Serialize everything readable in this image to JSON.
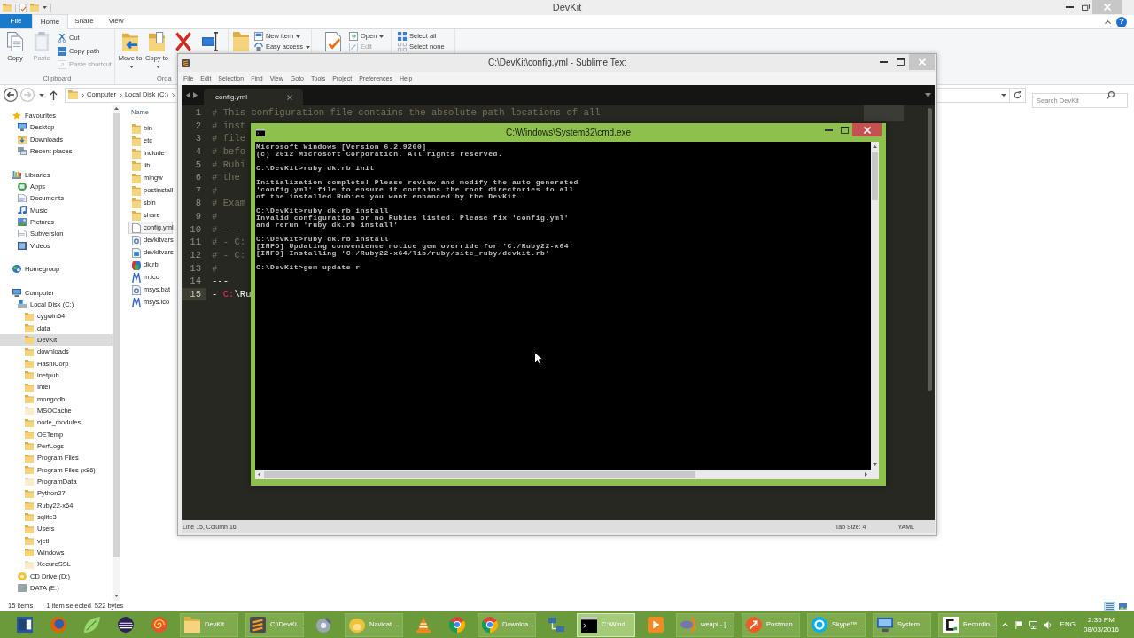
{
  "explorer": {
    "title": "DevKit",
    "active": false,
    "ribbon": {
      "tabs": [
        {
          "label": "File",
          "kind": "file",
          "selected": false
        },
        {
          "label": "Home",
          "kind": "tab",
          "selected": true
        },
        {
          "label": "Share",
          "kind": "tab",
          "selected": false
        },
        {
          "label": "View",
          "kind": "tab",
          "selected": false
        }
      ],
      "help": "?",
      "groups": [
        {
          "label": "Clipboard",
          "large": [
            {
              "kind": "copy",
              "label": "Copy",
              "dropdown": false,
              "disabled": false
            },
            {
              "kind": "paste",
              "label": "Paste",
              "dropdown": false,
              "disabled": true
            }
          ],
          "small": [
            {
              "kind": "cut",
              "label": "Cut",
              "dropdown": false,
              "disabled": false
            },
            {
              "kind": "copy-path",
              "label": "Copy path",
              "dropdown": false,
              "disabled": false
            },
            {
              "kind": "paste-shortcut",
              "label": "Paste shortcut",
              "dropdown": false,
              "disabled": true
            }
          ]
        },
        {
          "label": "Orga",
          "large": [
            {
              "kind": "move",
              "label": "Move to",
              "dropdown": true,
              "disabled": false
            },
            {
              "kind": "copy-to",
              "label": "Copy to",
              "dropdown": true,
              "disabled": false
            },
            {
              "kind": "delete",
              "disabled": false
            },
            {
              "kind": "rename",
              "disabled": false
            }
          ]
        },
        {
          "large": [
            {
              "kind": "new-folder",
              "disabled": false
            }
          ],
          "small": [
            {
              "kind": "new-item",
              "label": "New item",
              "dropdown": true,
              "disabled": false
            },
            {
              "kind": "easy-access",
              "label": "Easy access",
              "dropdown": true,
              "disabled": false
            }
          ]
        },
        {
          "large": [
            {
              "kind": "properties",
              "disabled": false
            }
          ],
          "small": [
            {
              "kind": "open",
              "label": "Open",
              "dropdown": true,
              "disabled": false
            },
            {
              "kind": "edit",
              "label": "Edit",
              "dropdown": false,
              "disabled": true
            }
          ]
        },
        {
          "small": [
            {
              "kind": "select-all",
              "label": "Select all",
              "dropdown": false,
              "disabled": false
            },
            {
              "kind": "select-none",
              "label": "Select none",
              "dropdown": false,
              "disabled": false
            }
          ]
        }
      ]
    },
    "address": {
      "crumbs": [
        "Computer",
        "Local Disk (C:)"
      ]
    },
    "search": {
      "placeholder": "Search DevKit"
    },
    "navigation": [
      {
        "label": "Favourites",
        "kind": "star",
        "selected": false,
        "children": [
          {
            "label": "Desktop",
            "kind": "desktop",
            "selected": false
          },
          {
            "label": "Downloads",
            "kind": "downloads",
            "selected": false
          },
          {
            "label": "Recent places",
            "kind": "recent",
            "selected": false
          }
        ]
      },
      {
        "label": "Libraries",
        "kind": "library",
        "selected": false,
        "children": [
          {
            "label": "Apps",
            "kind": "apps",
            "selected": false
          },
          {
            "label": "Documents",
            "kind": "documents",
            "selected": false
          },
          {
            "label": "Music",
            "kind": "music",
            "selected": false
          },
          {
            "label": "Pictures",
            "kind": "pictures",
            "selected": false
          },
          {
            "label": "Subversion",
            "kind": "subversion",
            "selected": false
          },
          {
            "label": "Videos",
            "kind": "videos",
            "selected": false
          }
        ]
      },
      {
        "label": "Homegroup",
        "kind": "homegroup",
        "selected": false
      },
      {
        "label": "Computer",
        "kind": "computer",
        "selected": false,
        "children": [
          {
            "label": "Local Disk (C:)",
            "kind": "disk",
            "selected": false,
            "children": [
              {
                "label": "cygwin64",
                "kind": "folder",
                "selected": false,
                "hidden": false
              },
              {
                "label": "data",
                "kind": "folder",
                "selected": false,
                "hidden": false
              },
              {
                "label": "DevKit",
                "kind": "folder",
                "selected": true,
                "hidden": false
              },
              {
                "label": "downloads",
                "kind": "folder",
                "selected": false,
                "hidden": false
              },
              {
                "label": "HashiCorp",
                "kind": "folder",
                "selected": false,
                "hidden": false
              },
              {
                "label": "inetpub",
                "kind": "folder",
                "selected": false,
                "hidden": false
              },
              {
                "label": "Intel",
                "kind": "folder",
                "selected": false,
                "hidden": false
              },
              {
                "label": "mongodb",
                "kind": "folder",
                "selected": false,
                "hidden": false
              },
              {
                "label": "MSOCache",
                "kind": "folder",
                "selected": false,
                "hidden": true
              },
              {
                "label": "node_modules",
                "kind": "folder",
                "selected": false,
                "hidden": false
              },
              {
                "label": "OETemp",
                "kind": "folder",
                "selected": false,
                "hidden": false
              },
              {
                "label": "PerfLogs",
                "kind": "folder",
                "selected": false,
                "hidden": false
              },
              {
                "label": "Program Files",
                "kind": "folder",
                "selected": false,
                "hidden": false
              },
              {
                "label": "Program Files (x86)",
                "kind": "folder",
                "selected": false,
                "hidden": false
              },
              {
                "label": "ProgramData",
                "kind": "folder",
                "selected": false,
                "hidden": true
              },
              {
                "label": "Python27",
                "kind": "folder",
                "selected": false,
                "hidden": false
              },
              {
                "label": "Ruby22-x64",
                "kind": "folder",
                "selected": false,
                "hidden": false
              },
              {
                "label": "sqlite3",
                "kind": "folder",
                "selected": false,
                "hidden": false
              },
              {
                "label": "Users",
                "kind": "folder",
                "selected": false,
                "hidden": false
              },
              {
                "label": "vjetl",
                "kind": "folder",
                "selected": false,
                "hidden": false
              },
              {
                "label": "Windows",
                "kind": "folder",
                "selected": false,
                "hidden": false
              },
              {
                "label": "XecureSSL",
                "kind": "folder",
                "selected": false,
                "hidden": true
              }
            ]
          },
          {
            "label": "CD Drive (D:)",
            "kind": "cd",
            "selected": false
          },
          {
            "label": "DATA (E:)",
            "kind": "drive",
            "selected": false
          }
        ]
      }
    ],
    "file_list": {
      "column": "Name",
      "items": [
        {
          "name": "bin",
          "kind": "folder",
          "selected": false
        },
        {
          "name": "etc",
          "kind": "folder",
          "selected": false
        },
        {
          "name": "include",
          "kind": "folder",
          "selected": false
        },
        {
          "name": "lib",
          "kind": "folder",
          "selected": false
        },
        {
          "name": "mingw",
          "kind": "folder",
          "selected": false
        },
        {
          "name": "postinstall",
          "kind": "folder",
          "selected": false
        },
        {
          "name": "sbin",
          "kind": "folder",
          "selected": false
        },
        {
          "name": "share",
          "kind": "folder",
          "selected": false
        },
        {
          "name": "config.yml",
          "kind": "text",
          "selected": true
        },
        {
          "name": "devkitvars",
          "kind": "script",
          "selected": false
        },
        {
          "name": "devkitvars",
          "kind": "command",
          "selected": false
        },
        {
          "name": "dk.rb",
          "kind": "ruby",
          "selected": false
        },
        {
          "name": "m.ico",
          "kind": "logo",
          "selected": false
        },
        {
          "name": "msys.bat",
          "kind": "script",
          "selected": false
        },
        {
          "name": "msys.ico",
          "kind": "logo",
          "selected": false
        }
      ]
    },
    "status": {
      "count": "15 items",
      "selection": "1 item selected",
      "size": "522 bytes"
    },
    "view_modes": [
      {
        "kind": "details",
        "selected": true
      },
      {
        "kind": "thumbnails",
        "selected": false
      }
    ]
  },
  "editor_window": {
    "title": "C:\\DevKit\\config.yml - Sublime Text",
    "active": false,
    "menu": [
      "File",
      "Edit",
      "Selection",
      "Find",
      "View",
      "Goto",
      "Tools",
      "Project",
      "Preferences",
      "Help"
    ],
    "tabs": [
      {
        "label": "config.yml",
        "selected": true
      }
    ],
    "lines": [
      {
        "number": "1",
        "current": false,
        "tokens": [
          {
            "text": "# This configuration file contains the absolute path locations of all",
            "kind": "comment"
          }
        ]
      },
      {
        "number": "2",
        "current": false,
        "tokens": [
          {
            "text": "# inst",
            "kind": "comment"
          }
        ]
      },
      {
        "number": "3",
        "current": false,
        "tokens": [
          {
            "text": "# file",
            "kind": "comment"
          }
        ]
      },
      {
        "number": "4",
        "current": false,
        "tokens": [
          {
            "text": "# befo",
            "kind": "comment"
          }
        ]
      },
      {
        "number": "5",
        "current": false,
        "tokens": [
          {
            "text": "# Rubi",
            "kind": "comment"
          }
        ]
      },
      {
        "number": "6",
        "current": false,
        "tokens": [
          {
            "text": "# the",
            "kind": "comment"
          }
        ]
      },
      {
        "number": "7",
        "current": false,
        "tokens": [
          {
            "text": "#",
            "kind": "comment"
          }
        ]
      },
      {
        "number": "8",
        "current": false,
        "tokens": [
          {
            "text": "# Exam",
            "kind": "comment"
          }
        ]
      },
      {
        "number": "9",
        "current": false,
        "tokens": [
          {
            "text": "#",
            "kind": "comment"
          }
        ]
      },
      {
        "number": "10",
        "current": false,
        "tokens": [
          {
            "text": "# ---",
            "kind": "comment"
          }
        ]
      },
      {
        "number": "11",
        "current": false,
        "tokens": [
          {
            "text": "# - C:",
            "kind": "comment"
          }
        ]
      },
      {
        "number": "12",
        "current": false,
        "tokens": [
          {
            "text": "# - C:",
            "kind": "comment"
          }
        ]
      },
      {
        "number": "13",
        "current": false,
        "tokens": [
          {
            "text": "#",
            "kind": "comment"
          }
        ]
      },
      {
        "number": "14",
        "current": false,
        "tokens": [
          {
            "text": "---",
            "kind": "plain"
          }
        ]
      },
      {
        "number": "15",
        "current": true,
        "tokens": [
          {
            "text": "- ",
            "kind": "plain"
          },
          {
            "text": "C:",
            "kind": "symbol"
          },
          {
            "text": "\\Ru",
            "kind": "plain"
          }
        ]
      }
    ],
    "status": {
      "position": "Line 15, Column 16",
      "tab_size": "Tab Size: 4",
      "syntax": "YAML"
    }
  },
  "console_window": {
    "title": "C:\\Windows\\System32\\cmd.exe",
    "active": true,
    "blocks": [
      [
        "Microsoft Windows [Version 6.2.9200]",
        "(c) 2012 Microsoft Corporation. All rights reserved."
      ],
      [
        "C:\\DevKit>ruby dk.rb init"
      ],
      [
        "Initialization complete! Please review and modify the auto-generated",
        "'config.yml' file to ensure it contains the root directories to all",
        "of the installed Rubies you want enhanced by the DevKit."
      ],
      [
        "C:\\DevKit>ruby dk.rb install",
        "Invalid configuration or no Rubies listed. Please fix 'config.yml'",
        "and rerun 'ruby dk.rb install'"
      ],
      [
        "C:\\DevKit>ruby dk.rb install",
        "[INFO] Updating convenience notice gem override for 'C:/Ruby22-x64'",
        "[INFO] Installing 'C:/Ruby22-x64/lib/ruby/site_ruby/devkit.rb'"
      ],
      [
        "C:\\DevKit>gem update r"
      ]
    ]
  },
  "taskbar": {
    "items": [
      {
        "kind": "document",
        "selected": false
      },
      {
        "kind": "globe",
        "selected": false
      },
      {
        "kind": "leaf",
        "selected": false
      },
      {
        "kind": "striped-circle",
        "selected": false
      },
      {
        "kind": "spiral",
        "selected": false
      },
      {
        "kind": "folder",
        "label": "DevKit",
        "selected": false
      },
      {
        "kind": "stripes-tile",
        "label": "C:\\DevKi...",
        "selected": false
      },
      {
        "kind": "satellite",
        "selected": false
      },
      {
        "kind": "blob",
        "label": "Navicat ...",
        "selected": false
      },
      {
        "kind": "cone",
        "selected": false
      },
      {
        "kind": "wheel",
        "selected": false
      },
      {
        "kind": "wheel",
        "label": "Downloa...",
        "selected": false
      },
      {
        "kind": "network",
        "selected": false
      },
      {
        "kind": "terminal",
        "label": "C:\\Wind...",
        "selected": true
      },
      {
        "kind": "play",
        "selected": false
      },
      {
        "kind": "emblem",
        "label": "weapi - [...",
        "selected": false
      },
      {
        "kind": "rocket",
        "label": "Postman",
        "selected": false
      },
      {
        "kind": "cloud",
        "label": "Skype™ ...",
        "selected": false
      },
      {
        "kind": "monitor",
        "label": "System",
        "selected": false
      },
      {
        "kind": "bracket",
        "label": "Recordin...",
        "selected": false
      }
    ],
    "tray": {
      "language": "ENG",
      "time": "2:35 PM",
      "date": "08/03/2016"
    }
  }
}
